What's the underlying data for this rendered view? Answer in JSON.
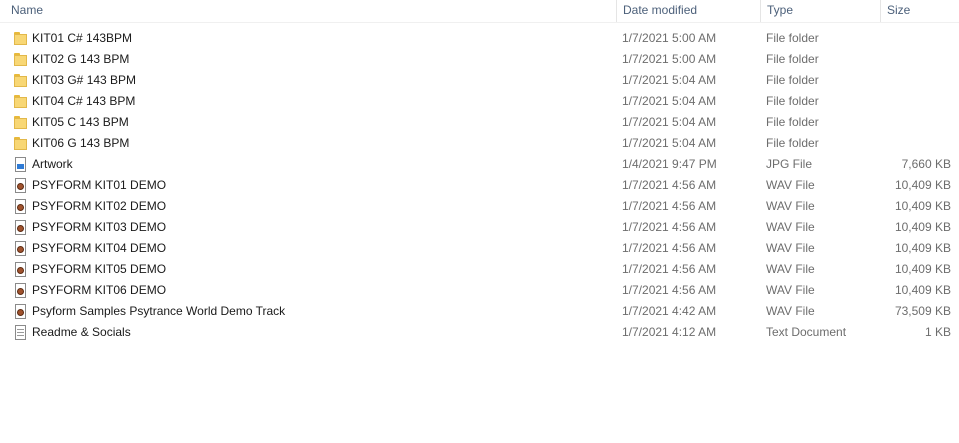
{
  "columns": {
    "name": "Name",
    "date_modified": "Date modified",
    "type": "Type",
    "size": "Size"
  },
  "files": [
    {
      "name": "KIT01 C# 143BPM",
      "date": "1/7/2021 5:00 AM",
      "type": "File folder",
      "size": "",
      "icon": "folder-icon"
    },
    {
      "name": "KIT02 G 143 BPM",
      "date": "1/7/2021 5:00 AM",
      "type": "File folder",
      "size": "",
      "icon": "folder-icon"
    },
    {
      "name": "KIT03 G# 143 BPM",
      "date": "1/7/2021 5:04 AM",
      "type": "File folder",
      "size": "",
      "icon": "folder-icon"
    },
    {
      "name": "KIT04 C# 143 BPM",
      "date": "1/7/2021 5:04 AM",
      "type": "File folder",
      "size": "",
      "icon": "folder-icon"
    },
    {
      "name": "KIT05 C 143 BPM",
      "date": "1/7/2021 5:04 AM",
      "type": "File folder",
      "size": "",
      "icon": "folder-icon"
    },
    {
      "name": "KIT06 G 143 BPM",
      "date": "1/7/2021 5:04 AM",
      "type": "File folder",
      "size": "",
      "icon": "folder-icon"
    },
    {
      "name": "Artwork",
      "date": "1/4/2021 9:47 PM",
      "type": "JPG File",
      "size": "7,660 KB",
      "icon": "jpg-file-icon"
    },
    {
      "name": "PSYFORM KIT01 DEMO",
      "date": "1/7/2021 4:56 AM",
      "type": "WAV File",
      "size": "10,409 KB",
      "icon": "wav-file-icon"
    },
    {
      "name": "PSYFORM KIT02 DEMO",
      "date": "1/7/2021 4:56 AM",
      "type": "WAV File",
      "size": "10,409 KB",
      "icon": "wav-file-icon"
    },
    {
      "name": "PSYFORM KIT03 DEMO",
      "date": "1/7/2021 4:56 AM",
      "type": "WAV File",
      "size": "10,409 KB",
      "icon": "wav-file-icon"
    },
    {
      "name": "PSYFORM KIT04 DEMO",
      "date": "1/7/2021 4:56 AM",
      "type": "WAV File",
      "size": "10,409 KB",
      "icon": "wav-file-icon"
    },
    {
      "name": "PSYFORM KIT05 DEMO",
      "date": "1/7/2021 4:56 AM",
      "type": "WAV File",
      "size": "10,409 KB",
      "icon": "wav-file-icon"
    },
    {
      "name": "PSYFORM KIT06 DEMO",
      "date": "1/7/2021 4:56 AM",
      "type": "WAV File",
      "size": "10,409 KB",
      "icon": "wav-file-icon"
    },
    {
      "name": "Psyform Samples Psytrance World Demo Track",
      "date": "1/7/2021 4:42 AM",
      "type": "WAV File",
      "size": "73,509 KB",
      "icon": "wav-file-icon"
    },
    {
      "name": "Readme & Socials",
      "date": "1/7/2021 4:12 AM",
      "type": "Text Document",
      "size": "1 KB",
      "icon": "text-file-icon"
    }
  ],
  "colors": {
    "header_text": "#4c607a",
    "secondary_text": "#6d6d6d",
    "folder": "#f8d775"
  }
}
